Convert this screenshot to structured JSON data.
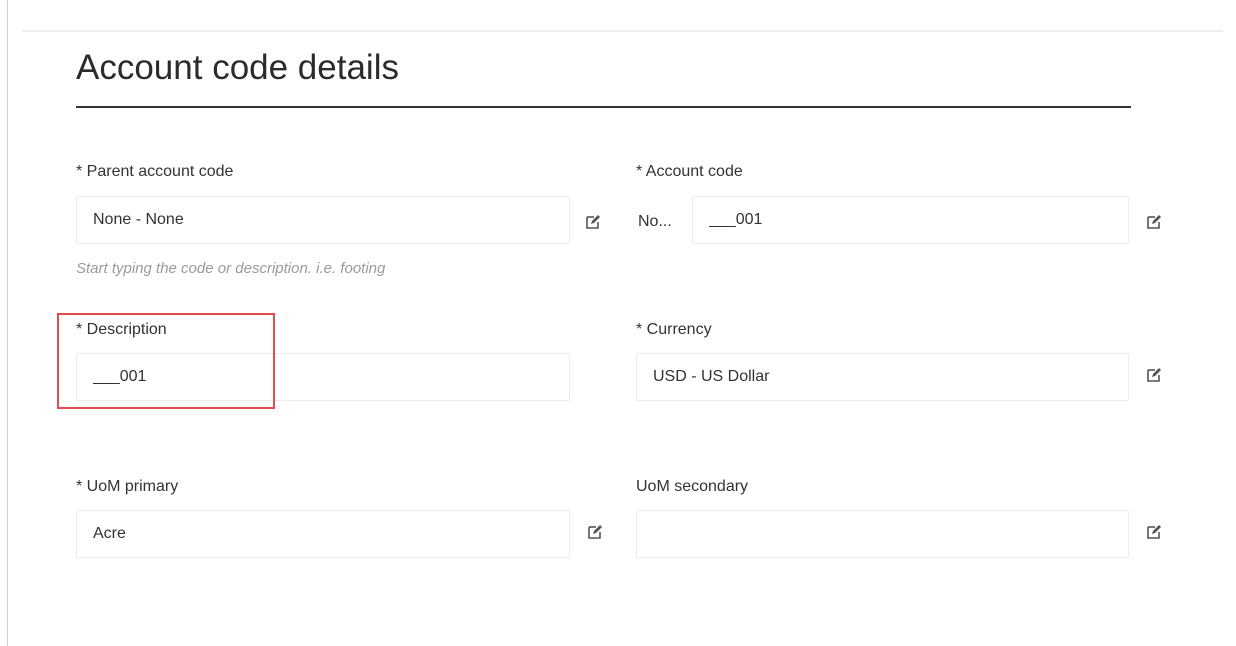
{
  "page": {
    "title": "Account code details"
  },
  "form": {
    "parent_account_code": {
      "label": "* Parent account code",
      "value": "None - None",
      "hint": "Start typing the code or description. i.e. footing",
      "edit_icon": "edit-icon"
    },
    "account_code": {
      "label": "* Account code",
      "prefix": "No...",
      "value": "___001",
      "edit_icon": "edit-icon"
    },
    "description": {
      "label": "* Description",
      "value": "___001"
    },
    "currency": {
      "label": "* Currency",
      "value": "USD - US Dollar",
      "edit_icon": "edit-icon"
    },
    "uom_primary": {
      "label": "* UoM primary",
      "value": "Acre",
      "edit_icon": "edit-icon"
    },
    "uom_secondary": {
      "label": "UoM secondary",
      "value": "",
      "edit_icon": "edit-icon"
    }
  },
  "colors": {
    "highlight": "#e24c4c",
    "rule": "#333333",
    "hint": "#9a9a9a"
  }
}
